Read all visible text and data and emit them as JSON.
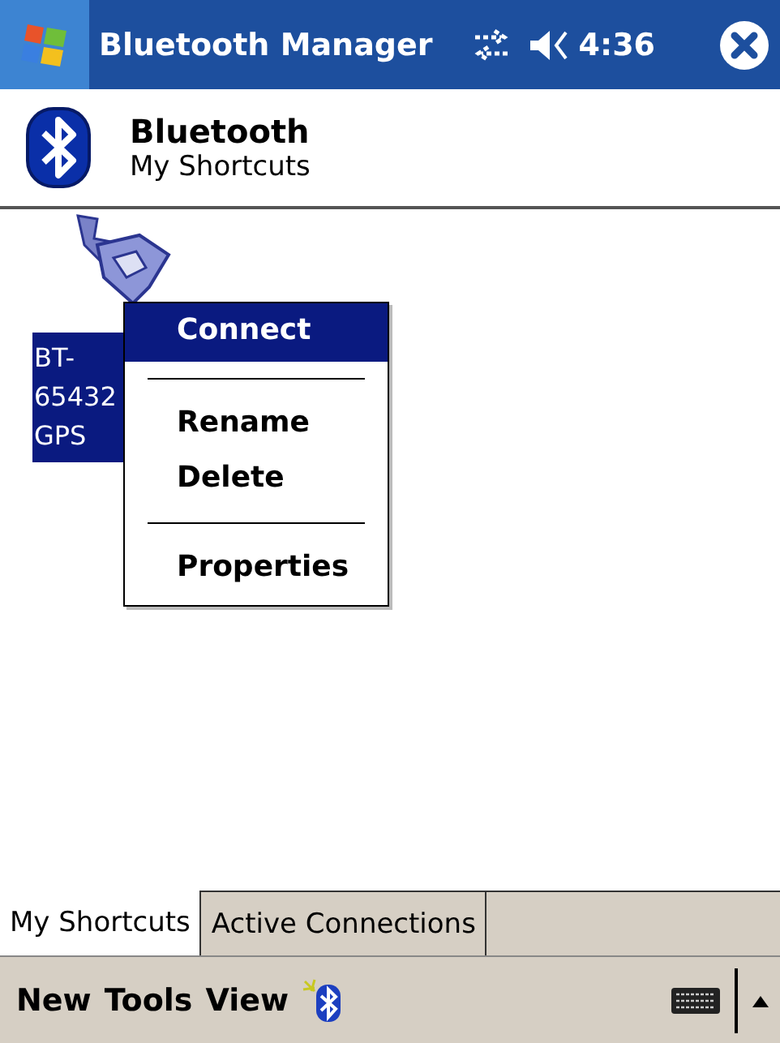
{
  "title_bar": {
    "title": "Bluetooth Manager",
    "time": "4:36"
  },
  "header": {
    "title": "Bluetooth",
    "subtitle": "My Shortcuts"
  },
  "shortcut": {
    "label_lines": [
      "BT-",
      "65432",
      "GPS"
    ],
    "selected": true
  },
  "context_menu": [
    {
      "kind": "item",
      "label": "Connect",
      "selected": true
    },
    {
      "kind": "separator"
    },
    {
      "kind": "item",
      "label": "Rename",
      "selected": false
    },
    {
      "kind": "item",
      "label": "Delete",
      "selected": false
    },
    {
      "kind": "separator"
    },
    {
      "kind": "item",
      "label": "Properties",
      "selected": false
    }
  ],
  "tabs": [
    {
      "label": "My Shortcuts",
      "selected": true
    },
    {
      "label": "Active Connections",
      "selected": false
    }
  ],
  "menu_bar": [
    "New",
    "Tools",
    "View"
  ]
}
